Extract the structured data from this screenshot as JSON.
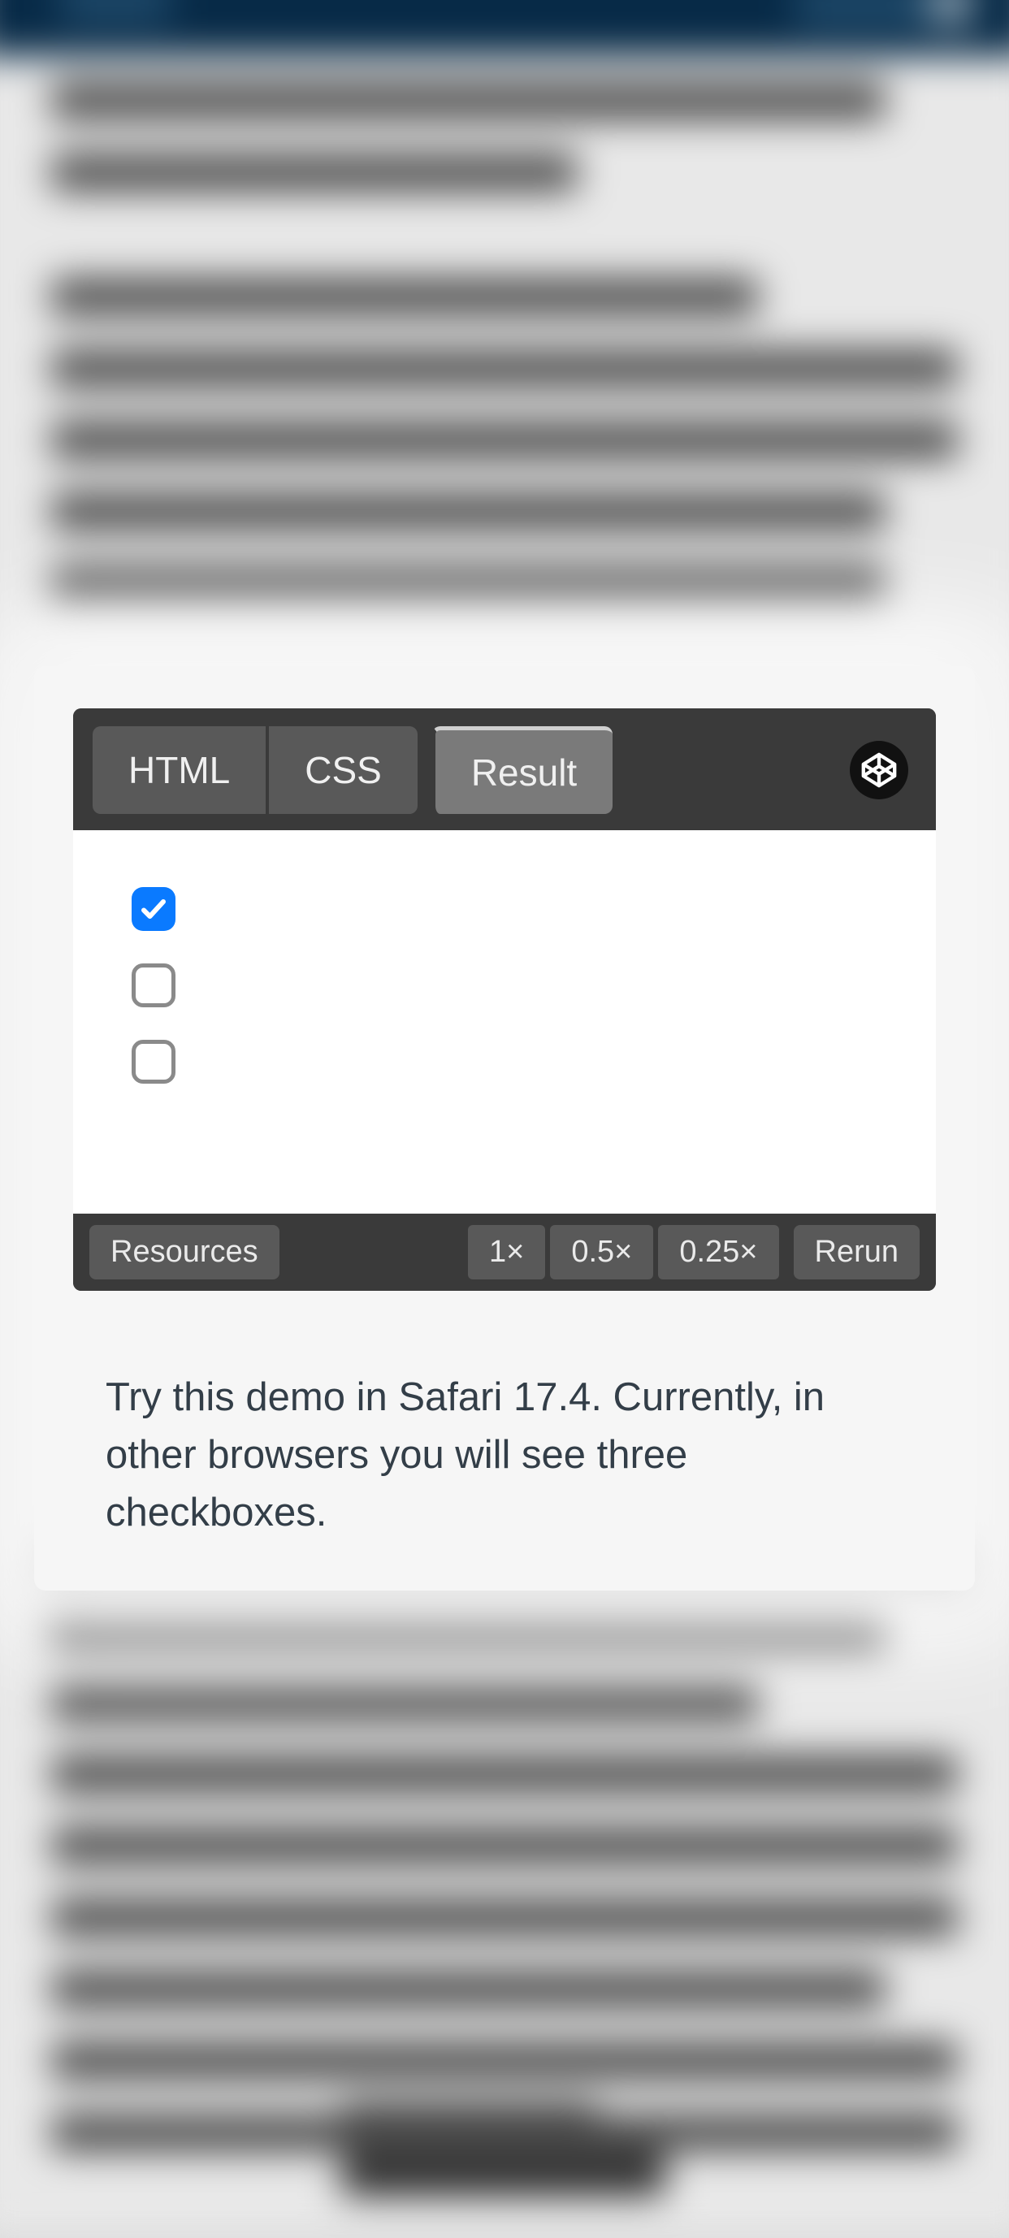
{
  "codepen": {
    "tabs": {
      "html": "HTML",
      "css": "CSS",
      "result": "Result"
    },
    "checkboxes": [
      {
        "checked": true
      },
      {
        "checked": false
      },
      {
        "checked": false
      }
    ],
    "footer": {
      "resources": "Resources",
      "zoom_1x": "1×",
      "zoom_05x": "0.5×",
      "zoom_025x": "0.25×",
      "rerun": "Rerun"
    }
  },
  "caption": "Try this demo in Safari 17.4. Currently, in other browsers you will see three checkboxes."
}
